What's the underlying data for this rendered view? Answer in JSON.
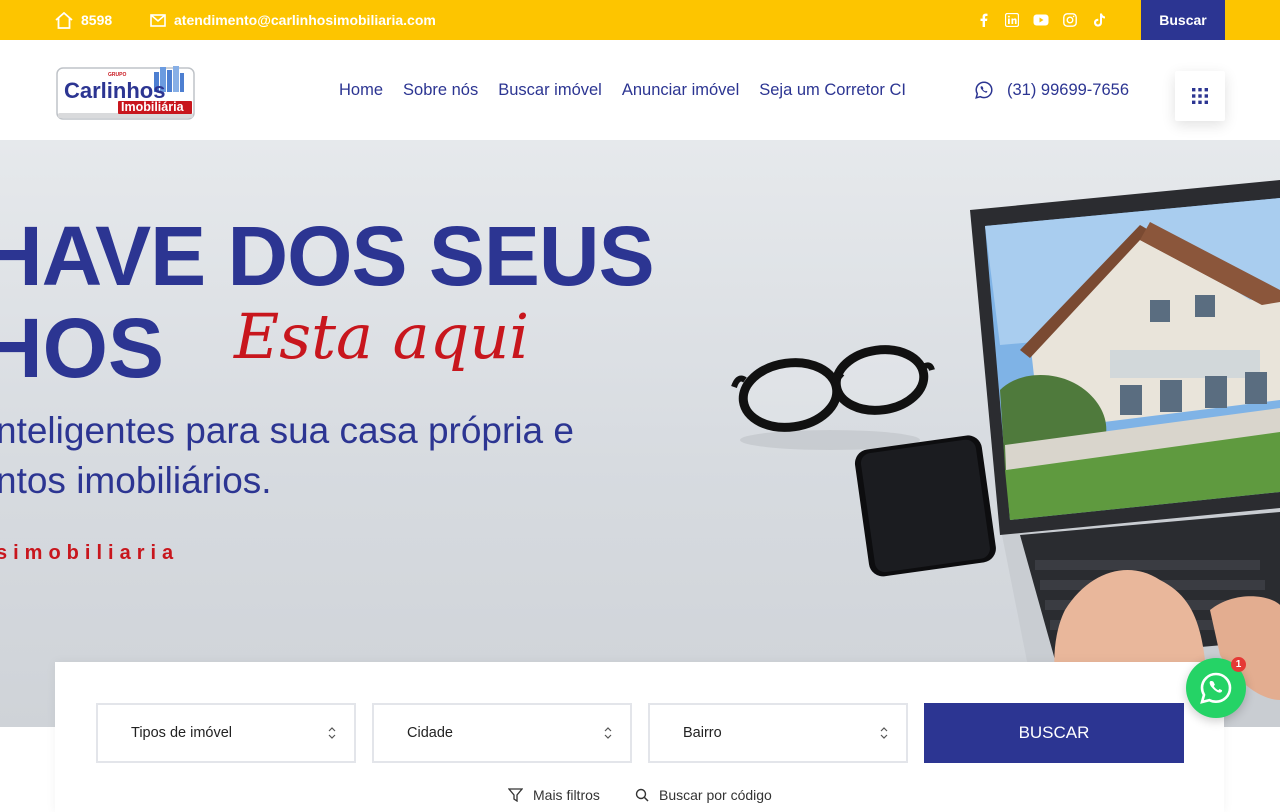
{
  "topbar": {
    "phone": "8598",
    "email": "atendimento@carlinhosimobiliaria.com",
    "socials": [
      "facebook-icon",
      "linkedin-icon",
      "youtube-icon",
      "instagram-icon",
      "tiktok-icon"
    ],
    "search_label": "Buscar"
  },
  "header": {
    "logo": {
      "line1": "Carlinhos",
      "line2": "Imobiliária",
      "small": "GRUPO"
    },
    "nav": [
      "Home",
      "Sobre nós",
      "Buscar imóvel",
      "Anunciar imóvel",
      "Seja um Corretor CI"
    ],
    "phone": "(31) 99699-7656"
  },
  "hero": {
    "title_line1": "HAVE DOS SEUS",
    "title_line2": "HOS",
    "script": "Esta aqui",
    "subtitle_line1": "nteligentes para sua casa própria e",
    "subtitle_line2": "ntos imobiliários.",
    "brand": "simobiliaria"
  },
  "search": {
    "selects": [
      "Tipos de imóvel",
      "Cidade",
      "Bairro"
    ],
    "button": "BUSCAR",
    "more_filters": "Mais filtros",
    "by_code": "Buscar por código"
  },
  "whatsapp": {
    "badge": "1"
  },
  "colors": {
    "yellow": "#FDC500",
    "navy": "#2C3592",
    "red": "#C8161D",
    "green": "#25D366"
  }
}
